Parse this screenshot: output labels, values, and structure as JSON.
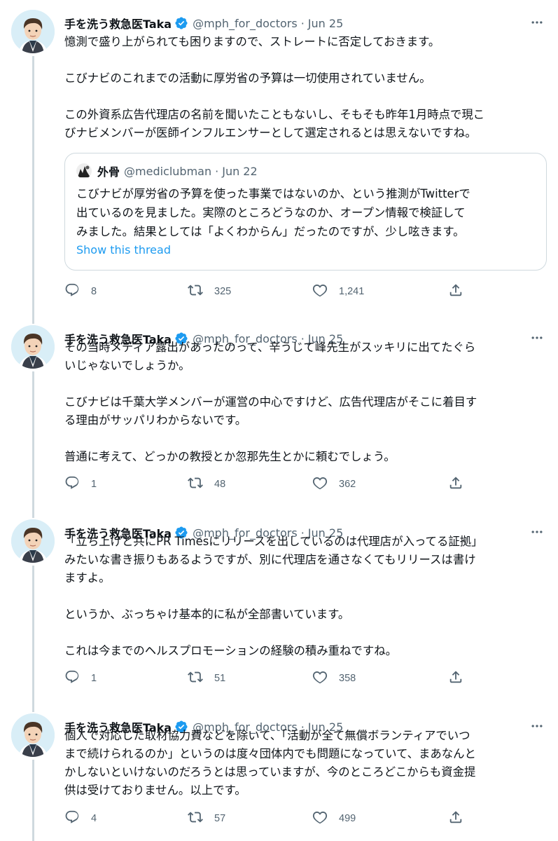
{
  "tweets": [
    {
      "author": {
        "name": "手を洗う救急医Taka",
        "handle": "@mph_for_doctors",
        "verified": true
      },
      "separator": "·",
      "date": "Jun 25",
      "paragraphs": [
        "憶測で盛り上がられても困りますので、ストレートに否定しておきます。",
        "こびナビのこれまでの活動に厚労省の予算は一切使用されていません。",
        "この外資系広告代理店の名前を聞いたこともないし、そもそも昨年1月時点で現こ\nびナビメンバーが医師インフルエンサーとして選定されるとは思えないですね。"
      ],
      "quote": {
        "author": {
          "name": "外骨",
          "handle": "@mediclubman"
        },
        "separator": "·",
        "date": "Jun 22",
        "text": "こびナビが厚労省の予算を使った事業ではないのか、という推測がTwitterで\n出ているのを見ました。実際のところどうなのか、オープン情報で検証して\nみました。結果としては「よくわからん」だったのですが、少し呟きます。",
        "link": "Show this thread"
      },
      "stats": {
        "replies": "8",
        "retweets": "325",
        "likes": "1,241"
      }
    },
    {
      "author": {
        "name": "手を洗う救急医Taka",
        "handle": "@mph_for_doctors",
        "verified": true
      },
      "separator": "·",
      "date": "Jun 25",
      "paragraphs": [
        "その当時メディア露出があったのって、辛うじて峰先生がスッキリに出てたぐら\nいじゃないでしょうか。",
        "こびナビは千葉大学メンバーが運営の中心ですけど、広告代理店がそこに着目す\nる理由がサッパリわからないです。",
        "普通に考えて、どっかの教授とか忽那先生とかに頼むでしょう。"
      ],
      "stats": {
        "replies": "1",
        "retweets": "48",
        "likes": "362"
      }
    },
    {
      "author": {
        "name": "手を洗う救急医Taka",
        "handle": "@mph_for_doctors",
        "verified": true
      },
      "separator": "·",
      "date": "Jun 25",
      "paragraphs": [
        "「立ち上げと共にPR Timesにリリースを出しているのは代理店が入ってる証拠」\nみたいな書き振りもあるようですが、別に代理店を通さなくてもリリースは書け\nますよ。",
        "というか、ぶっちゃけ基本的に私が全部書いています。",
        "これは今までのヘルスプロモーションの経験の積み重ねですね。"
      ],
      "stats": {
        "replies": "1",
        "retweets": "51",
        "likes": "358"
      }
    },
    {
      "author": {
        "name": "手を洗う救急医Taka",
        "handle": "@mph_for_doctors",
        "verified": true
      },
      "separator": "·",
      "date": "Jun 25",
      "paragraphs": [
        "個人で対応した取材協力費などを除いて、「活動が全て無償ボランティアでいつ\nまで続けられるのか」というのは度々団体内でも問題になっていて、まあなんと\nかしないといけないのだろうとは思っていますが、今のところどこからも資金提\n供は受けておりません。以上です。"
      ],
      "stats": {
        "replies": "4",
        "retweets": "57",
        "likes": "499"
      }
    }
  ],
  "icons": {
    "more": "more-horizontal-icon",
    "verified": "verified-badge-icon",
    "reply": "reply-icon",
    "retweet": "retweet-icon",
    "like": "heart-icon",
    "share": "share-icon"
  },
  "colors": {
    "text": "#0f1419",
    "secondary": "#536471",
    "accent": "#1d9bf0",
    "border": "#cfd9de"
  }
}
